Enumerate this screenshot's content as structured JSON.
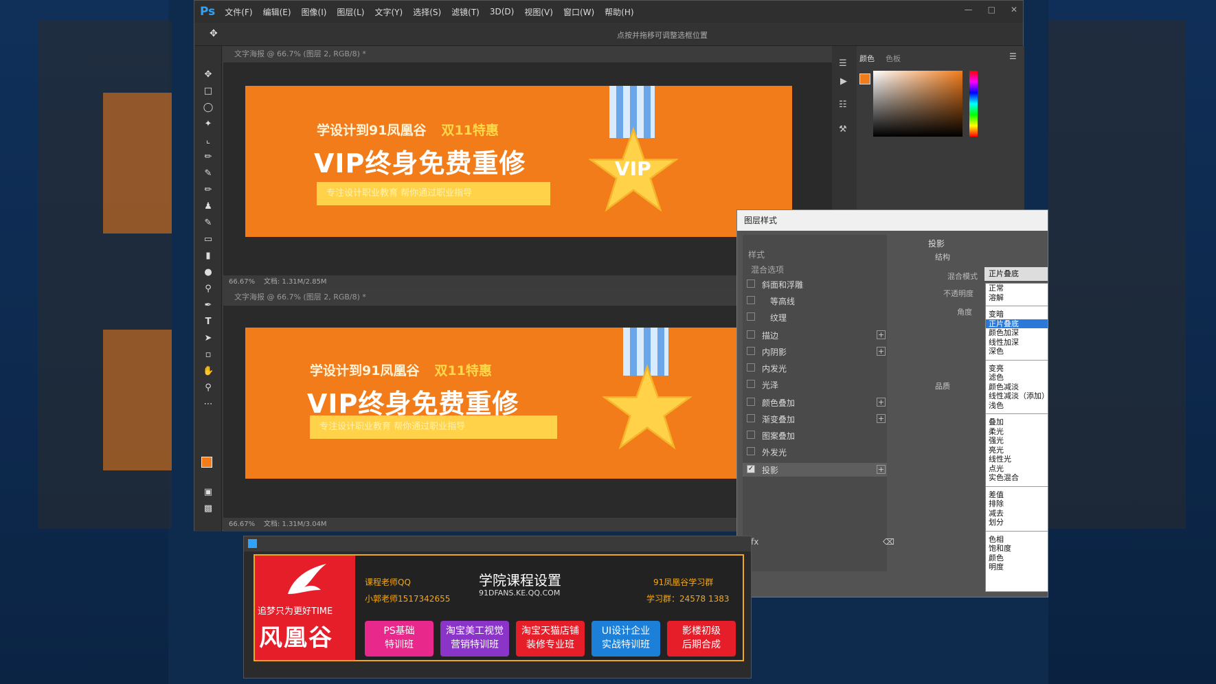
{
  "app": {
    "logo": "Ps"
  },
  "menus": [
    "文件(F)",
    "编辑(E)",
    "图像(I)",
    "图层(L)",
    "文字(Y)",
    "选择(S)",
    "滤镜(T)",
    "3D(D)",
    "视图(V)",
    "窗口(W)",
    "帮助(H)"
  ],
  "optbar": {
    "hint": "点按并拖移可调整选框位置"
  },
  "docs": [
    {
      "tab": "文字海报 @ 66.7% (图层 2, RGB/8) *",
      "status_zoom": "66.67%",
      "status_doc": "文档: 1.31M/2.85M"
    },
    {
      "tab": "文字海报 @ 66.7% (图层 2, RGB/8) *",
      "status_zoom": "66.67%",
      "status_doc": "文档: 1.31M/3.04M"
    }
  ],
  "banner": {
    "sub": "学设计到91凤凰谷",
    "sub_hl": "双11特惠",
    "main": "VIP终身免费重修",
    "bar_text": "专注设计职业教育 帮你通过职业指导",
    "medal": "VIP"
  },
  "right_panel": {
    "tab1": "颜色",
    "tab2": "色板",
    "accent": "#f27c1a"
  },
  "dialog": {
    "title": "图层样式",
    "styles_heading": "样式",
    "blend_opts": "混合选项",
    "items": [
      {
        "label": "斜面和浮雕",
        "plus": false,
        "checked": false
      },
      {
        "label": "等高线",
        "plus": false,
        "checked": false
      },
      {
        "label": "纹理",
        "plus": false,
        "checked": false
      },
      {
        "label": "描边",
        "plus": true,
        "checked": false
      },
      {
        "label": "内阴影",
        "plus": true,
        "checked": false
      },
      {
        "label": "内发光",
        "plus": false,
        "checked": false
      },
      {
        "label": "光泽",
        "plus": false,
        "checked": false
      },
      {
        "label": "颜色叠加",
        "plus": true,
        "checked": false
      },
      {
        "label": "渐变叠加",
        "plus": true,
        "checked": false
      },
      {
        "label": "图案叠加",
        "plus": false,
        "checked": false
      },
      {
        "label": "外发光",
        "plus": false,
        "checked": false
      },
      {
        "label": "投影",
        "plus": true,
        "checked": true
      }
    ],
    "section": "投影",
    "structure": "结构",
    "blend_mode_label": "混合模式",
    "blend_mode_value": "正片叠底",
    "opacity_label": "不透明度",
    "angle_label": "角度",
    "quality": "品质"
  },
  "blend_modes": [
    [
      "正常",
      "溶解"
    ],
    [
      "变暗",
      "正片叠底",
      "颜色加深",
      "线性加深",
      "深色"
    ],
    [
      "变亮",
      "滤色",
      "颜色减淡",
      "线性减淡（添加）",
      "浅色"
    ],
    [
      "叠加",
      "柔光",
      "强光",
      "亮光",
      "线性光",
      "点光",
      "实色混合"
    ],
    [
      "差值",
      "排除",
      "减去",
      "划分"
    ],
    [
      "色相",
      "饱和度",
      "颜色",
      "明度"
    ]
  ],
  "ad": {
    "brand_slogan": "追梦只为更好TIME",
    "brand_name": "风凰谷",
    "teacher_qq_label": "课程老师QQ",
    "teacher_qq": "小郭老师1517342655",
    "title": "学院课程设置",
    "site": "91DFANS.KE.QQ.COM",
    "group_label": "91凤凰谷学习群",
    "group_no": "学习群：24578 1383",
    "courses": [
      "PS基础\n特训班",
      "淘宝美工视觉\n营销特训班",
      "淘宝天猫店铺\n装修专业班",
      "UI设计企业\n实战特训班",
      "影楼初级\n后期合成"
    ]
  }
}
